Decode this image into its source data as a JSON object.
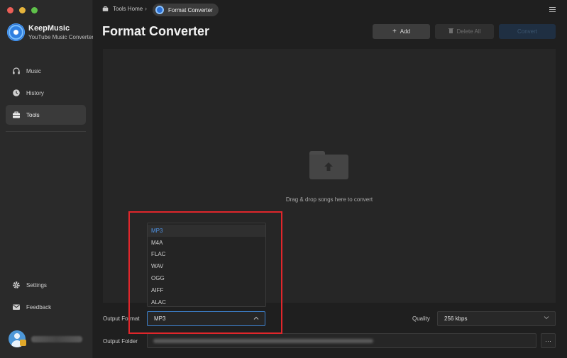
{
  "app": {
    "name": "KeepMusic",
    "subtitle": "YouTube Music Converter"
  },
  "sidebar": {
    "items": [
      {
        "label": "Music",
        "icon": "headphones-icon",
        "active": false
      },
      {
        "label": "History",
        "icon": "clock-icon",
        "active": false
      },
      {
        "label": "Tools",
        "icon": "toolbox-icon",
        "active": true
      }
    ],
    "bottom_items": [
      {
        "label": "Settings",
        "icon": "gear-icon"
      },
      {
        "label": "Feedback",
        "icon": "mail-icon"
      }
    ]
  },
  "breadcrumb": {
    "home": "Tools Home",
    "current": "Format Converter"
  },
  "page": {
    "title": "Format Converter"
  },
  "toolbar": {
    "add_label": "Add",
    "delete_all_label": "Delete All",
    "convert_label": "Convert"
  },
  "dropzone": {
    "text": "Drag & drop songs here to convert"
  },
  "settings": {
    "output_format_label": "Output Format",
    "output_format_value": "MP3",
    "format_options": [
      "MP3",
      "M4A",
      "FLAC",
      "WAV",
      "OGG",
      "AIFF",
      "ALAC"
    ],
    "quality_label": "Quality",
    "quality_value": "256 kbps",
    "output_folder_label": "Output Folder",
    "browse_label": "···"
  },
  "colors": {
    "accent": "#3d7fc9",
    "highlight": "#e0262b",
    "selected_option": "#4f93e6"
  }
}
